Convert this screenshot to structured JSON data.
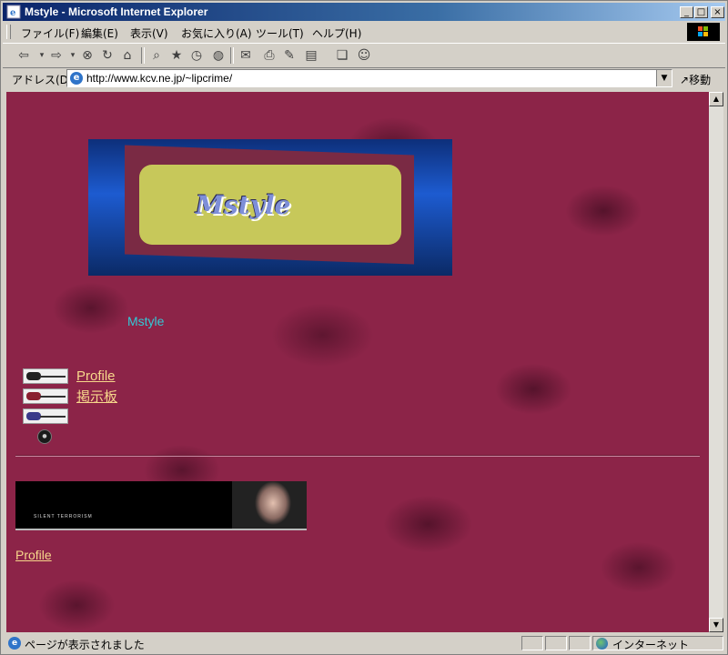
{
  "window": {
    "title": "Mstyle - Microsoft Internet Explorer",
    "controls": {
      "minimize": "_",
      "maximize": "□",
      "close": "×"
    }
  },
  "menu": [
    "ファイル(F)",
    "編集(E)",
    "表示(V)",
    "お気に入り(A)",
    "ツール(T)",
    "ヘルプ(H)"
  ],
  "toolbar": {
    "icons": [
      "back-icon",
      "forward-icon",
      "stop-icon",
      "refresh-icon",
      "home-icon",
      "search-icon",
      "favorites-icon",
      "history-icon",
      "globe-icon",
      "mail-icon",
      "print-icon",
      "edit-icon",
      "discuss-icon",
      "messenger-icon"
    ]
  },
  "address": {
    "label": "アドレス(D)",
    "url": "http://www.kcv.ne.jp/~lipcrime/",
    "go_label": "移動"
  },
  "page": {
    "banner_logo": "Mstyle",
    "site_name": "Mstyle",
    "nav_links": [
      "Profile",
      "掲示板"
    ],
    "photo_caption": "SILENT TERRORISM",
    "bottom_link": "Profile",
    "background_color": "#8c2448",
    "link_color": "#f7d78b",
    "site_name_color": "#33c9d6"
  },
  "status": {
    "text": "ページが表示されました",
    "zone": "インターネット"
  }
}
